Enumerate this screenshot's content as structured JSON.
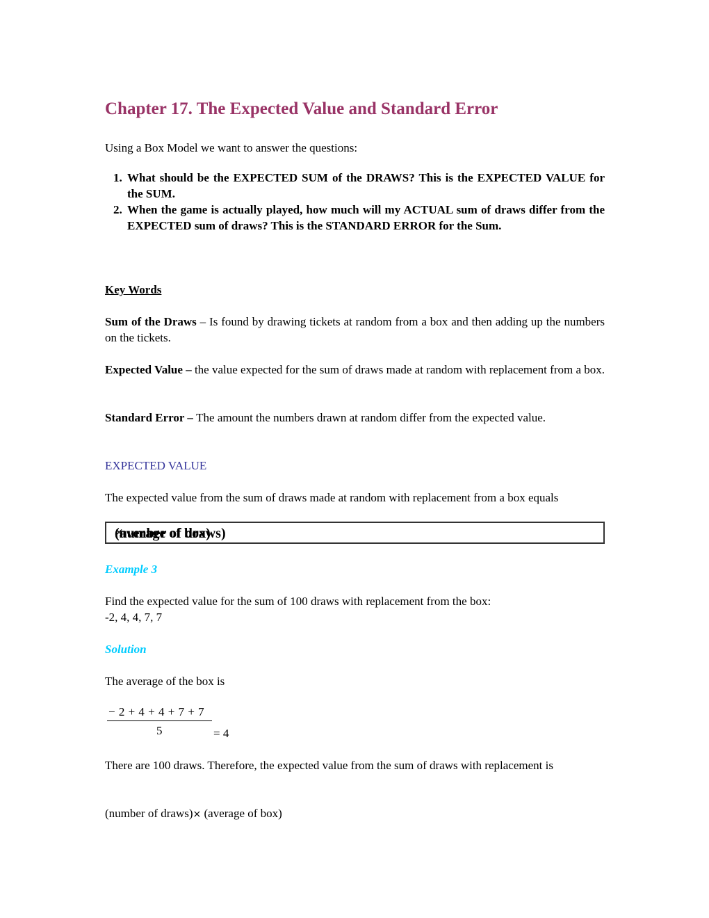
{
  "document": {
    "title": "Chapter 17.  The Expected Value and Standard Error",
    "intro": "Using a Box Model we want to answer the questions:",
    "questions": [
      {
        "number": "1.",
        "text": "What should be the EXPECTED SUM of the DRAWS? This is the EXPECTED VALUE for the SUM."
      },
      {
        "number": "2.",
        "text": "When the game is actually played, how much will my ACTUAL sum of draws differ from the EXPECTED sum of draws? This is the STANDARD ERROR for the Sum."
      }
    ],
    "key_words_heading": "Key Words ",
    "definitions": [
      {
        "term": "Sum of the Draws",
        "sep": " – ",
        "text": "Is found by drawing tickets at random from a box and then adding up the numbers on the tickets."
      },
      {
        "term": "Expected Value",
        "sep": " – ",
        "text": "the value expected for the sum of draws made at random with replacement from a box."
      },
      {
        "term": "Standard Error",
        "sep": " – ",
        "text": "The amount the numbers drawn at random differ from the expected value."
      }
    ],
    "section_heading": "EXPECTED VALUE",
    "section_text": "The expected value from the sum of draws made at random with replacement from a box equals",
    "formula": {
      "left": "(number of draws)",
      "operator": "×",
      "right": "(average of box)"
    },
    "example_heading": "Example 3",
    "example_text": "Find the expected value for the sum of 100 draws with replacement from the box:",
    "example_box": "-2, 4, 4, 7, 7",
    "solution_heading": "Solution",
    "solution_text": "The average of the box is",
    "fraction": {
      "numerator": "− 2 + 4 + 4 + 7 + 7",
      "denominator": "5",
      "result": "=  4"
    },
    "conclusion_text": "There are 100 draws.  Therefore, the expected value from the sum of draws with replacement is",
    "formula_repeat": {
      "left": "(number of draws)",
      "operator": "×",
      "right": " (average of box)"
    }
  },
  "colors": {
    "title": "#993366",
    "section_heading": "#333399",
    "example_heading": "#00ccff"
  }
}
